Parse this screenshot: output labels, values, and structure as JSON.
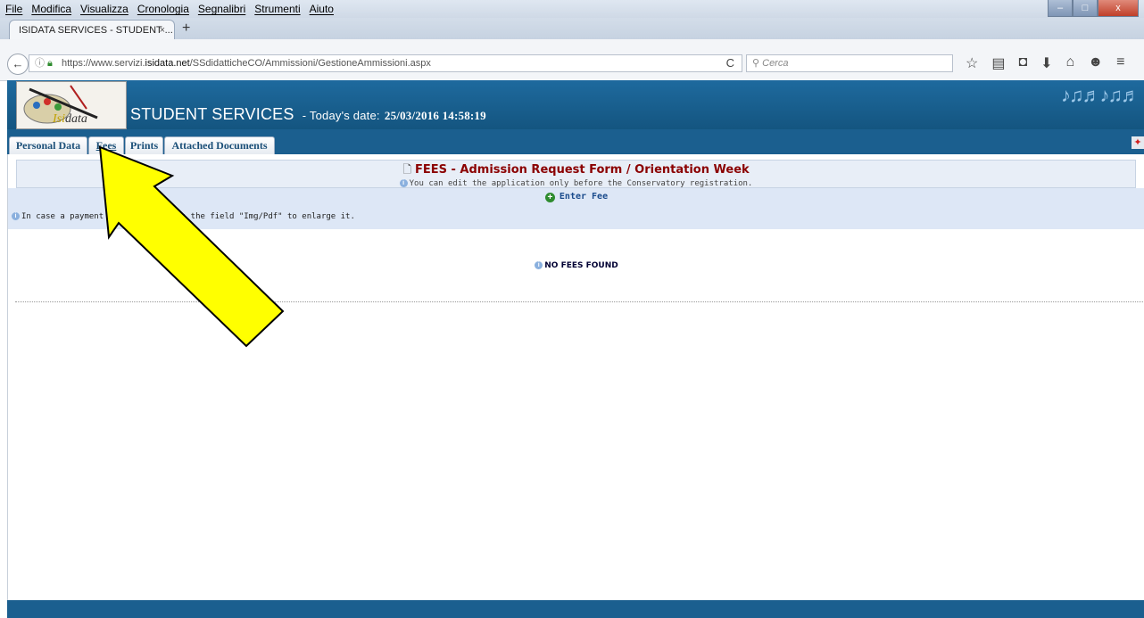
{
  "window": {
    "menu": [
      "File",
      "Modifica",
      "Visualizza",
      "Cronologia",
      "Segnalibri",
      "Strumenti",
      "Aiuto"
    ],
    "controls": {
      "minimize": "–",
      "maximize": "□",
      "close": "x"
    }
  },
  "browser": {
    "tab_title": "ISIDATA SERVICES - STUDENT ...",
    "tab_close": "×",
    "new_tab": "+",
    "back": "←",
    "url_prefix": "https://www.servizi.",
    "url_domain": "isidata.net",
    "url_path": "/SSdidatticheCO/Ammissioni/GestioneAmmissioni.aspx",
    "reload": "C",
    "search_placeholder": "Cerca",
    "toolbar_icons": [
      "star-icon",
      "library-icon",
      "pocket-icon",
      "download-icon",
      "home-icon",
      "chat-icon",
      "menu-icon"
    ]
  },
  "header": {
    "logo_text_accent": "Isi",
    "logo_text": "data",
    "site_title": "STUDENT SERVICES",
    "date_prefix": "- Today's date:",
    "date_value": "25/03/2016 14:58:19"
  },
  "tabs": [
    {
      "label": "Personal Data"
    },
    {
      "label": "Fees"
    },
    {
      "label": "Prints"
    },
    {
      "label": "Attached Documents"
    }
  ],
  "form": {
    "title": "FEES - Admission Request Form / Orientation Week",
    "subtitle": "You can edit the application only before the Conservatory registration.",
    "enter_fee": "Enter Fee",
    "receipt_note": "In case a payment receipt click on the field \"Img/Pdf\" to enlarge it.",
    "empty_message": "NO FEES FOUND"
  },
  "colors": {
    "header_blue": "#1b5f8f",
    "title_red": "#8b0000",
    "arrow_yellow": "#ffff00"
  }
}
